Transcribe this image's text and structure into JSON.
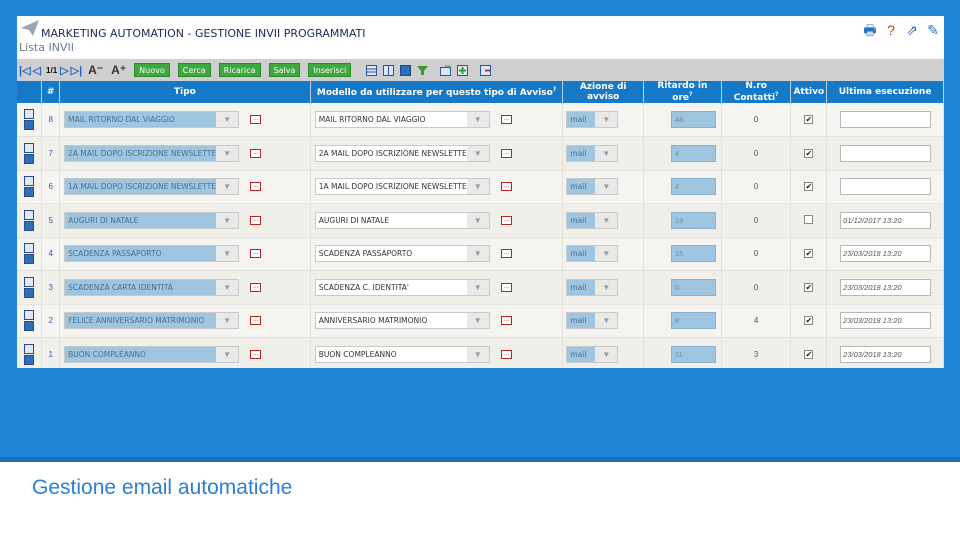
{
  "app": {
    "title": "MARKETING AUTOMATION - GESTIONE INVII PROGRAMMATI",
    "subtitle": "Lista INVII",
    "header_icons": [
      "printer-icon",
      "help-icon",
      "external-link-icon",
      "edit-icon"
    ]
  },
  "toolbar": {
    "page_count": "1/1",
    "buttons": {
      "nuovo": "Nuovo",
      "cerca": "Cerca",
      "ricarica": "Ricarica",
      "salva": "Salva",
      "inserisci": "Inserisci"
    }
  },
  "table": {
    "headers": {
      "num": "#",
      "tipo": "Tipo",
      "modello": "Modello da utilizzare per questo tipo di Avviso",
      "azione": "Azione di avviso",
      "ritardo": "Ritardo in ore",
      "nro": "N.ro Contatti",
      "attivo": "Attivo",
      "ultima": "Ultima esecuzione"
    },
    "rows": [
      {
        "id": "8",
        "tipo": "MAIL RITORNO DAL VIAGGIO",
        "modello": "MAIL RITORNO DAL VIAGGIO",
        "azione": "mail",
        "ritardo": "48",
        "contatti": "0",
        "attivo": true,
        "ultima": ""
      },
      {
        "id": "7",
        "tipo": "2A MAIL DOPO ISCRIZIONE NEWSLETTER",
        "modello": "2A MAIL DOPO ISCRIZIONE NEWSLETTER",
        "azione": "mail",
        "ritardo": "4",
        "contatti": "0",
        "attivo": true,
        "ultima": ""
      },
      {
        "id": "6",
        "tipo": "1A MAIL DOPO ISCRIZIONE NEWSLETTER",
        "modello": "1A MAIL DOPO ISCRIZIONE NEWSLETTER",
        "azione": "mail",
        "ritardo": "4",
        "contatti": "0",
        "attivo": true,
        "ultima": ""
      },
      {
        "id": "5",
        "tipo": "AUGURI DI NATALE",
        "modello": "AUGURI DI NATALE",
        "azione": "mail",
        "ritardo": "19",
        "contatti": "0",
        "attivo": false,
        "ultima": "01/12/2017 13:20"
      },
      {
        "id": "4",
        "tipo": "SCADENZA PASSAPORTO",
        "modello": "SCADENZA PASSAPORTO",
        "azione": "mail",
        "ritardo": "15",
        "contatti": "0",
        "attivo": true,
        "ultima": "23/03/2018 13:20"
      },
      {
        "id": "3",
        "tipo": "SCADENZA CARTA IDENTITÀ",
        "modello": "SCADENZA C. IDENTITA'",
        "azione": "mail",
        "ritardo": "0",
        "contatti": "0",
        "attivo": true,
        "ultima": "23/03/2018 13:20"
      },
      {
        "id": "2",
        "tipo": "FELICE ANNIVERSARIO MATRIMONIO",
        "modello": "ANNIVERSARIO MATRIMONIO",
        "azione": "mail",
        "ritardo": "8",
        "contatti": "4",
        "attivo": true,
        "ultima": "23/03/2018 13:20"
      },
      {
        "id": "1",
        "tipo": "BUON COMPLEANNO",
        "modello": "BUON COMPLEANNO",
        "azione": "mail",
        "ritardo": "11",
        "contatti": "3",
        "attivo": true,
        "ultima": "23/03/2018 13:20"
      }
    ]
  },
  "caption": "Gestione email automatiche",
  "colors": {
    "background_band": "#2385d8",
    "header_blue": "#1579c8",
    "button_green": "#3fa83f",
    "field_blue": "#9fc5e0"
  }
}
